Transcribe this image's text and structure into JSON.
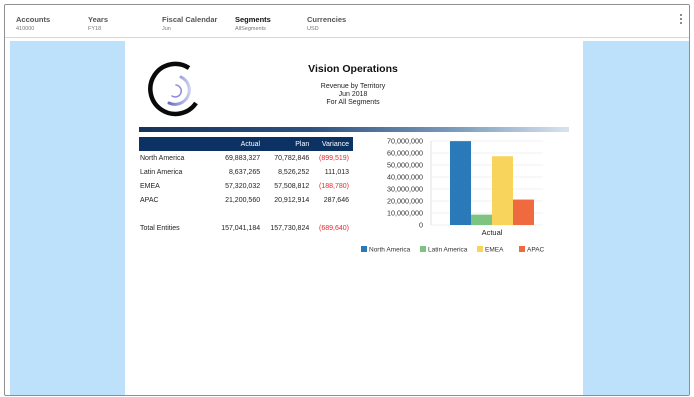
{
  "pov": [
    {
      "name": "Accounts",
      "value": "410000",
      "active": false
    },
    {
      "name": "Years",
      "value": "FY18",
      "active": false
    },
    {
      "name": "Fiscal Calendar",
      "value": "Jun",
      "active": false
    },
    {
      "name": "Segments",
      "value": "AllSegments",
      "active": true
    },
    {
      "name": "Currencies",
      "value": "USD",
      "active": false
    }
  ],
  "report": {
    "title": "Vision Operations",
    "subtitle_line1": "Revenue by Territory",
    "subtitle_line2": "Jun 2018",
    "subtitle_line3": "For All Segments"
  },
  "table": {
    "headers": [
      "",
      "Actual",
      "Plan",
      "Variance"
    ],
    "rows": [
      {
        "label": "North America",
        "actual": "69,883,327",
        "plan": "70,782,846",
        "variance": "(899,519)",
        "negative": true
      },
      {
        "label": "Latin America",
        "actual": "8,637,265",
        "plan": "8,526,252",
        "variance": "111,013",
        "negative": false
      },
      {
        "label": "EMEA",
        "actual": "57,320,032",
        "plan": "57,508,812",
        "variance": "(188,780)",
        "negative": true
      },
      {
        "label": "APAC",
        "actual": "21,200,560",
        "plan": "20,912,914",
        "variance": "287,646",
        "negative": false
      }
    ],
    "total": {
      "label": "Total Entities",
      "actual": "157,041,184",
      "plan": "157,730,824",
      "variance": "(689,640)",
      "negative": true
    }
  },
  "colors": {
    "header_bg": "#0b3262",
    "negative": "#e8262c",
    "side_panel": "#bde0fb"
  },
  "chart_data": {
    "type": "bar",
    "categories": [
      "Actual"
    ],
    "series": [
      {
        "name": "North America",
        "values": [
          69883327
        ],
        "color": "#2a7ab9"
      },
      {
        "name": "Latin America",
        "values": [
          8637265
        ],
        "color": "#7cc47f"
      },
      {
        "name": "EMEA",
        "values": [
          57320032
        ],
        "color": "#f9d45c"
      },
      {
        "name": "APAC",
        "values": [
          21200560
        ],
        "color": "#ef6b3f"
      }
    ],
    "ylim": [
      0,
      70000000
    ],
    "yticks": [
      0,
      10000000,
      20000000,
      30000000,
      40000000,
      50000000,
      60000000,
      70000000
    ],
    "ytick_labels": [
      "0",
      "10,000,000",
      "20,000,000",
      "30,000,000",
      "40,000,000",
      "50,000,000",
      "60,000,000",
      "70,000,000"
    ],
    "xlabel": "Actual",
    "legend": "bottom",
    "grid": true
  }
}
